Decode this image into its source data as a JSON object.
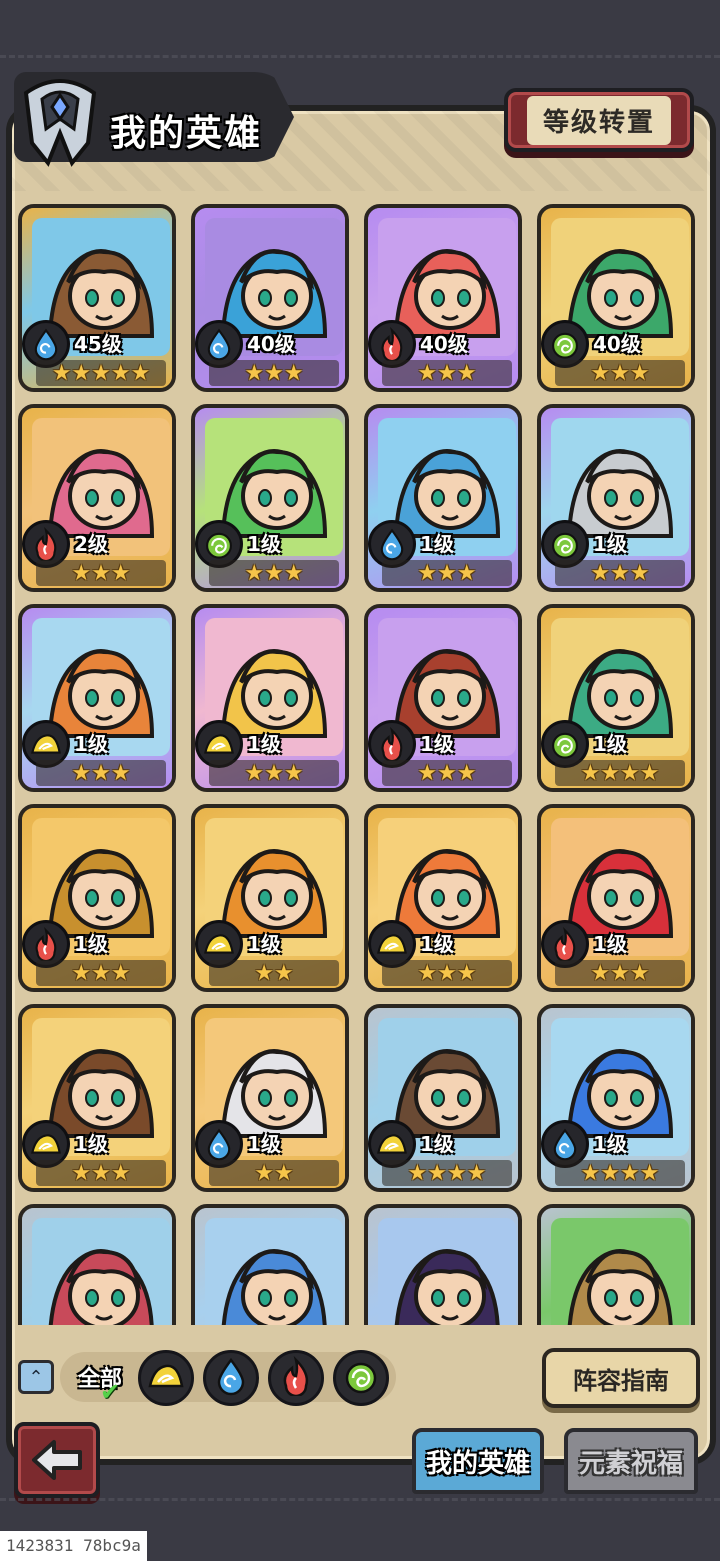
{
  "header": {
    "title": "我的英雄",
    "reset_button": "等级转置"
  },
  "colors": {
    "frame_gold": "#e8b34a",
    "frame_purple": "#b68cf0",
    "frame_silver": "#b9c4cf",
    "element_water": "#4aa6e6",
    "element_fire": "#e8504a",
    "element_wind": "#7cc83c",
    "element_earth": "#f2d23a"
  },
  "heroes": [
    {
      "level": "45级",
      "stars": "★★★★★",
      "element": "water-icon",
      "frame": "gold",
      "portrait": "#8a5a34",
      "bg": "#7fc8e8",
      "alert": false
    },
    {
      "level": "40级",
      "stars": "★★★",
      "element": "water-icon",
      "frame": "purple",
      "portrait": "#3aa2d8",
      "bg": "#a98be2",
      "alert": true
    },
    {
      "level": "40级",
      "stars": "★★★",
      "element": "fire-icon",
      "frame": "purple",
      "portrait": "#e8605a",
      "bg": "#c8a0ee",
      "alert": true
    },
    {
      "level": "40级",
      "stars": "★★★",
      "element": "wind-icon",
      "frame": "gold",
      "portrait": "#3ca86a",
      "bg": "#f0d27a",
      "alert": true
    },
    {
      "level": "2级",
      "stars": "★★★",
      "element": "fire-icon",
      "frame": "gold",
      "portrait": "#e06a8e",
      "bg": "#f2c27a",
      "alert": false
    },
    {
      "level": "1级",
      "stars": "★★★",
      "element": "wind-icon",
      "frame": "purple",
      "portrait": "#56c05a",
      "bg": "#b6e27a",
      "alert": false
    },
    {
      "level": "1级",
      "stars": "★★★",
      "element": "water-icon",
      "frame": "purple",
      "portrait": "#4aa2d8",
      "bg": "#8fd0f0",
      "alert": false
    },
    {
      "level": "1级",
      "stars": "★★★",
      "element": "wind-icon",
      "frame": "purple",
      "portrait": "#c8ccd0",
      "bg": "#9fd7ee",
      "alert": false
    },
    {
      "level": "1级",
      "stars": "★★★",
      "element": "earth-icon",
      "frame": "purple",
      "portrait": "#e8843a",
      "bg": "#a8d8f0",
      "alert": false
    },
    {
      "level": "1级",
      "stars": "★★★",
      "element": "earth-icon",
      "frame": "purple",
      "portrait": "#f2c44a",
      "bg": "#f0b8d0",
      "alert": false
    },
    {
      "level": "1级",
      "stars": "★★★",
      "element": "fire-icon",
      "frame": "purple",
      "portrait": "#a8402e",
      "bg": "#c8a0ee",
      "alert": false
    },
    {
      "level": "1级",
      "stars": "★★★★",
      "element": "wind-icon",
      "frame": "gold",
      "portrait": "#3cab84",
      "bg": "#f0d27a",
      "alert": false
    },
    {
      "level": "1级",
      "stars": "★★★",
      "element": "fire-icon",
      "frame": "gold",
      "portrait": "#c8902e",
      "bg": "#f4c86a",
      "alert": false
    },
    {
      "level": "1级",
      "stars": "★★",
      "element": "earth-icon",
      "frame": "gold",
      "portrait": "#e8902e",
      "bg": "#f4d27a",
      "alert": false
    },
    {
      "level": "1级",
      "stars": "★★★",
      "element": "earth-icon",
      "frame": "gold",
      "portrait": "#ee7a3a",
      "bg": "#f6d07a",
      "alert": false
    },
    {
      "level": "1级",
      "stars": "★★★",
      "element": "fire-icon",
      "frame": "gold",
      "portrait": "#d8303a",
      "bg": "#f4c07a",
      "alert": false
    },
    {
      "level": "1级",
      "stars": "★★★",
      "element": "earth-icon",
      "frame": "gold",
      "portrait": "#7a4a2a",
      "bg": "#f4d27a",
      "alert": false
    },
    {
      "level": "1级",
      "stars": "★★",
      "element": "water-icon",
      "frame": "gold",
      "portrait": "#e4e4e8",
      "bg": "#f4c87a",
      "alert": false
    },
    {
      "level": "1级",
      "stars": "★★★★",
      "element": "earth-icon",
      "frame": "silver",
      "portrait": "#6a4a34",
      "bg": "#9fd0ea",
      "alert": false
    },
    {
      "level": "1级",
      "stars": "★★★★",
      "element": "water-icon",
      "frame": "silver",
      "portrait": "#3a7ae0",
      "bg": "#a8d8f0",
      "alert": false
    },
    {
      "level": "",
      "stars": "",
      "element": "",
      "frame": "silver",
      "portrait": "#c84a5a",
      "bg": "#9fd0ea",
      "alert": false
    },
    {
      "level": "",
      "stars": "",
      "element": "",
      "frame": "silver",
      "portrait": "#4a8ad8",
      "bg": "#a8d0ee",
      "alert": false
    },
    {
      "level": "",
      "stars": "",
      "element": "",
      "frame": "silver",
      "portrait": "#3a2a5a",
      "bg": "#a8c8ee",
      "alert": false
    },
    {
      "level": "",
      "stars": "",
      "element": "",
      "frame": "silver",
      "portrait": "#b08a4a",
      "bg": "#7ac86a",
      "alert": false
    }
  ],
  "filter": {
    "all_label": "全部",
    "elements": [
      "earth-icon",
      "water-icon",
      "fire-icon",
      "wind-icon"
    ]
  },
  "guide_button": "阵容指南",
  "tabs": [
    {
      "label": "我的英雄",
      "active": true
    },
    {
      "label": "元素祝福",
      "active": false
    }
  ],
  "footer_id": "1423831 78bc9a"
}
